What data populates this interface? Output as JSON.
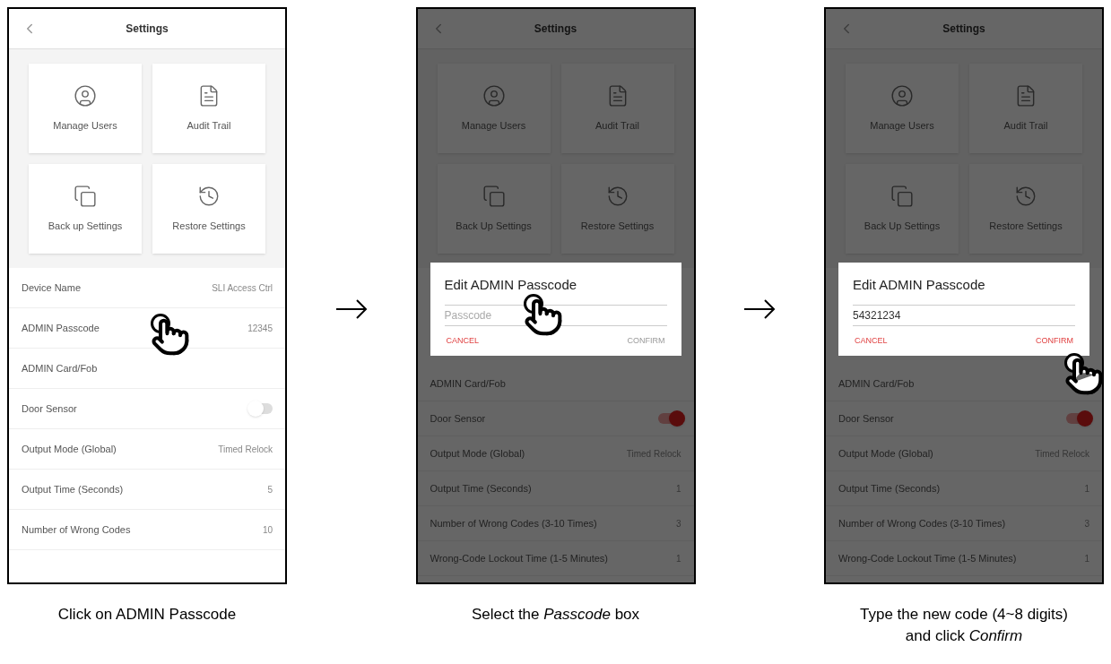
{
  "panels": [
    {
      "screen": {
        "title": "Settings",
        "tiles": [
          {
            "label": "Manage Users"
          },
          {
            "label": "Audit Trail"
          },
          {
            "label": "Back up Settings"
          },
          {
            "label": "Restore Settings"
          }
        ],
        "rows": [
          {
            "kind": "text",
            "label": "Device Name",
            "value": "SLI Access Ctrl"
          },
          {
            "kind": "text",
            "label": "ADMIN Passcode",
            "value": "12345"
          },
          {
            "kind": "text",
            "label": "ADMIN Card/Fob"
          },
          {
            "kind": "toggle",
            "label": "Door Sensor",
            "on": false
          },
          {
            "kind": "text",
            "label": "Output Mode (Global)",
            "value": "Timed Relock"
          },
          {
            "kind": "text",
            "label": "Output Time (Seconds)",
            "value": "5"
          },
          {
            "kind": "text",
            "label": "Number of Wrong Codes",
            "value": "10"
          }
        ]
      },
      "dimmed": false,
      "caption": "Click on ADMIN Passcode"
    },
    {
      "screen": {
        "title": "Settings",
        "tiles": [
          {
            "label": "Manage Users"
          },
          {
            "label": "Audit Trail"
          },
          {
            "label": "Back Up Settings"
          },
          {
            "label": "Restore Settings"
          }
        ],
        "rows": [
          {
            "kind": "text",
            "label": "ADMIN Card/Fob"
          },
          {
            "kind": "toggle",
            "label": "Door Sensor",
            "on": true
          },
          {
            "kind": "text",
            "label": "Output Mode (Global)",
            "value": "Timed Relock"
          },
          {
            "kind": "text",
            "label": "Output Time (Seconds)",
            "value": "1"
          },
          {
            "kind": "text",
            "label": "Number of Wrong Codes (3-10 Times)",
            "value": "3"
          },
          {
            "kind": "text",
            "label": "Wrong-Code Lockout Time (1-5 Minutes)",
            "value": "1"
          }
        ]
      },
      "dimmed": true,
      "dialog": {
        "title": "Edit ADMIN Passcode",
        "placeholder": "Passcode",
        "cancel": "CANCEL",
        "confirm": "CONFIRM",
        "confirm_disabled": true
      },
      "caption": "Select the *Passcode* box"
    },
    {
      "screen": {
        "title": "Settings",
        "tiles": [
          {
            "label": "Manage Users"
          },
          {
            "label": "Audit Trail"
          },
          {
            "label": "Back Up Settings"
          },
          {
            "label": "Restore Settings"
          }
        ],
        "rows": [
          {
            "kind": "text",
            "label": "ADMIN Card/Fob"
          },
          {
            "kind": "toggle",
            "label": "Door Sensor",
            "on": true
          },
          {
            "kind": "text",
            "label": "Output Mode (Global)",
            "value": "Timed Relock"
          },
          {
            "kind": "text",
            "label": "Output Time (Seconds)",
            "value": "1"
          },
          {
            "kind": "text",
            "label": "Number of Wrong Codes (3-10 Times)",
            "value": "3"
          },
          {
            "kind": "text",
            "label": "Wrong-Code Lockout Time (1-5 Minutes)",
            "value": "1"
          }
        ]
      },
      "dimmed": true,
      "dialog": {
        "title": "Edit ADMIN Passcode",
        "value": "54321234",
        "cancel": "CANCEL",
        "confirm": "CONFIRM",
        "confirm_disabled": false
      },
      "caption": "Type the new code (4~8 digits) and click *Confirm*"
    }
  ]
}
